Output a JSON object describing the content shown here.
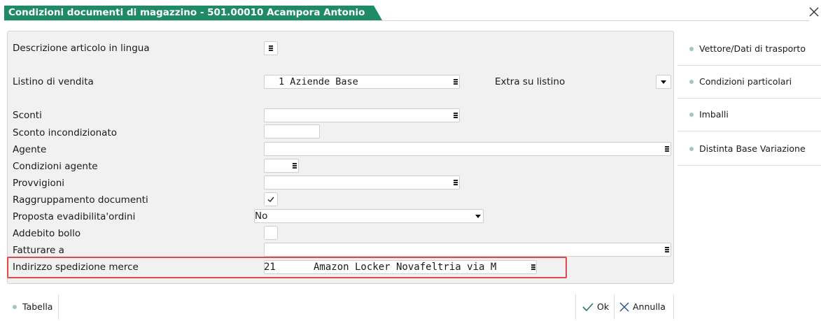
{
  "window": {
    "title": "Condizioni documenti di magazzino - 501.00010 Acampora Antonio",
    "accent": "#1e8a68",
    "close_icon": "close-icon"
  },
  "form": {
    "descrizione_label": "Descrizione articolo in lingua",
    "listino_label": "Listino di vendita",
    "listino_value": "1 Aziende Base",
    "extra_label": "Extra su listino",
    "sconti_label": "Sconti",
    "sconto_incond_label": "Sconto incondizionato",
    "agente_label": "Agente",
    "cond_agente_label": "Condizioni agente",
    "provvigioni_label": "Provvigioni",
    "raggruppamento_label": "Raggruppamento documenti",
    "raggruppamento_checked": true,
    "proposta_label": "Proposta evadibilita'ordini",
    "proposta_value": "No",
    "addebito_label": "Addebito bollo",
    "fatturare_label": "Fatturare a",
    "indirizzo_label": "Indirizzo spedizione merce",
    "indirizzo_code": "21",
    "indirizzo_value": "Amazon Locker Novafeltria via M",
    "highlight_color": "#e0484b"
  },
  "sidebar": {
    "items": [
      {
        "label": "Vettore/Dati di trasporto"
      },
      {
        "label": "Condizioni particolari"
      },
      {
        "label": "Imballi"
      },
      {
        "label": "Distinta Base Variazione"
      }
    ]
  },
  "footer": {
    "tabella_label": "Tabella",
    "ok_label": "Ok",
    "annulla_label": "Annulla"
  }
}
